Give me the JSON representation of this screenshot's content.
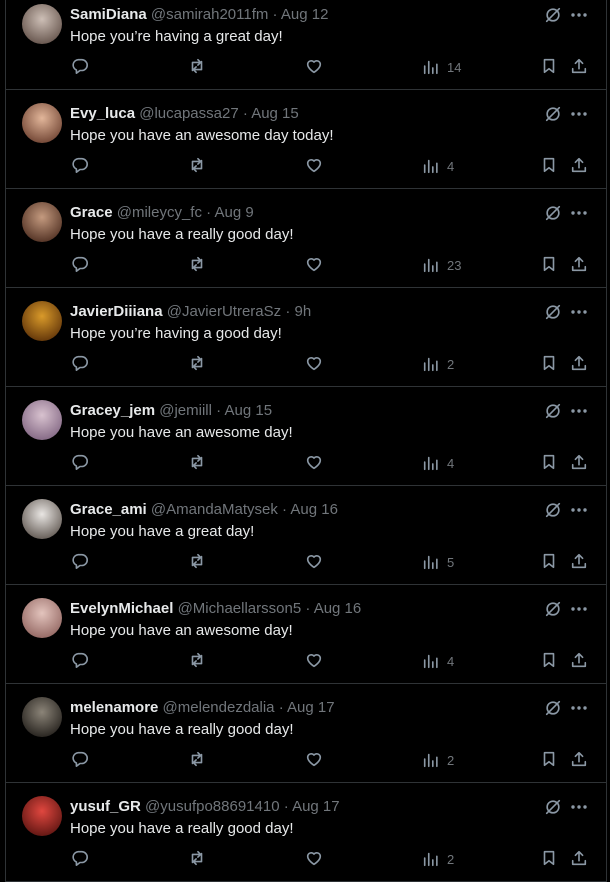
{
  "colors": {
    "background": "#000000",
    "text": "#e7e9ea",
    "muted": "#71767b",
    "divider": "#2f3336"
  },
  "tweets": [
    {
      "name": "SamiDiana",
      "handle": "@samirah2011fm",
      "dot": "·",
      "time": "Aug 12",
      "text": "Hope you’re having a great day!",
      "views": "14",
      "avatar": [
        "#cdbfb6",
        "#6e5d55"
      ]
    },
    {
      "name": "Evy_luca",
      "handle": "@lucapassa27",
      "dot": "·",
      "time": "Aug 15",
      "text": "Hope you have an awesome day today!",
      "views": "4",
      "avatar": [
        "#e2b69a",
        "#7a4e3c"
      ]
    },
    {
      "name": "Grace",
      "handle": "@mileycy_fc",
      "dot": "·",
      "time": "Aug 9",
      "text": "Hope you have a really good day!",
      "views": "23",
      "avatar": [
        "#c49a7f",
        "#5b3a2b"
      ]
    },
    {
      "name": "JavierDiiiana",
      "handle": "@JavierUtreraSz",
      "dot": "·",
      "time": "9h",
      "text": "Hope you’re having a good day!",
      "views": "2",
      "avatar": [
        "#d99a2a",
        "#6b3d0c"
      ]
    },
    {
      "name": "Gracey_jem",
      "handle": "@jemiill",
      "dot": "·",
      "time": "Aug 15",
      "text": "Hope you have an awesome day!",
      "views": "4",
      "avatar": [
        "#d8c2cf",
        "#8a6f8a"
      ]
    },
    {
      "name": "Grace_ami",
      "handle": "@AmandaMatysek",
      "dot": "·",
      "time": "Aug 16",
      "text": "Hope you have a great day!",
      "views": "5",
      "avatar": [
        "#e9e6e3",
        "#6e6660"
      ]
    },
    {
      "name": "EvelynMichael",
      "handle": "@Michaellarsson5",
      "dot": "·",
      "time": "Aug 16",
      "text": "Hope you have an awesome day!",
      "views": "4",
      "avatar": [
        "#e3c4bd",
        "#9a6f6a"
      ]
    },
    {
      "name": "melenamore",
      "handle": "@melendezdalia",
      "dot": "·",
      "time": "Aug 17",
      "text": "Hope you have a really good day!",
      "views": "2",
      "avatar": [
        "#8b8478",
        "#2e2a25"
      ]
    },
    {
      "name": "yusuf_GR",
      "handle": "@yusufpo88691410",
      "dot": "·",
      "time": "Aug 17",
      "text": "Hope you have a really good day!",
      "views": "2",
      "avatar": [
        "#e0473f",
        "#6a1a16"
      ]
    }
  ]
}
